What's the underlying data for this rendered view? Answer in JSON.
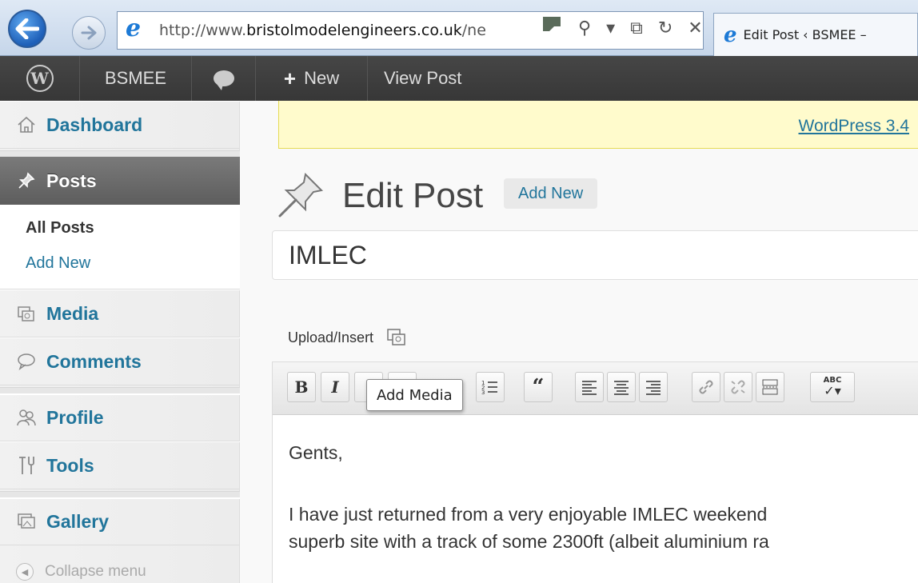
{
  "browser": {
    "address_prefix": "http://www.",
    "address_domain": "bristolmodelengineers.co.uk",
    "address_suffix": "/ne",
    "address_tools": "⚲ ▾ ⧉ ↻ ✕",
    "tab_title": "Edit Post ‹ BSMEE –"
  },
  "admin_bar": {
    "site_name": "BSMEE",
    "new_label": "New",
    "view_post_label": "View Post"
  },
  "sidebar": {
    "dashboard": "Dashboard",
    "posts": "Posts",
    "all_posts": "All Posts",
    "add_new": "Add New",
    "media": "Media",
    "comments": "Comments",
    "profile": "Profile",
    "tools": "Tools",
    "gallery": "Gallery",
    "collapse": "Collapse menu"
  },
  "main": {
    "notice_link": "WordPress 3.4",
    "page_title": "Edit Post",
    "add_new_button": "Add New",
    "post_title": "IMLEC",
    "upload_insert": "Upload/Insert",
    "tooltip": "Add Media",
    "toolbar": {
      "bold": "B",
      "italic": "I",
      "quote": "“",
      "spell": "ABC"
    },
    "body_lines": [
      "Gents,",
      "I have just returned from a very enjoyable IMLEC weekend",
      "superb site with a track of some 2300ft (albeit aluminium ra"
    ]
  },
  "colors": {
    "link": "#21759b",
    "admin_bar": "#464646",
    "notice_bg": "#fffbcc"
  }
}
